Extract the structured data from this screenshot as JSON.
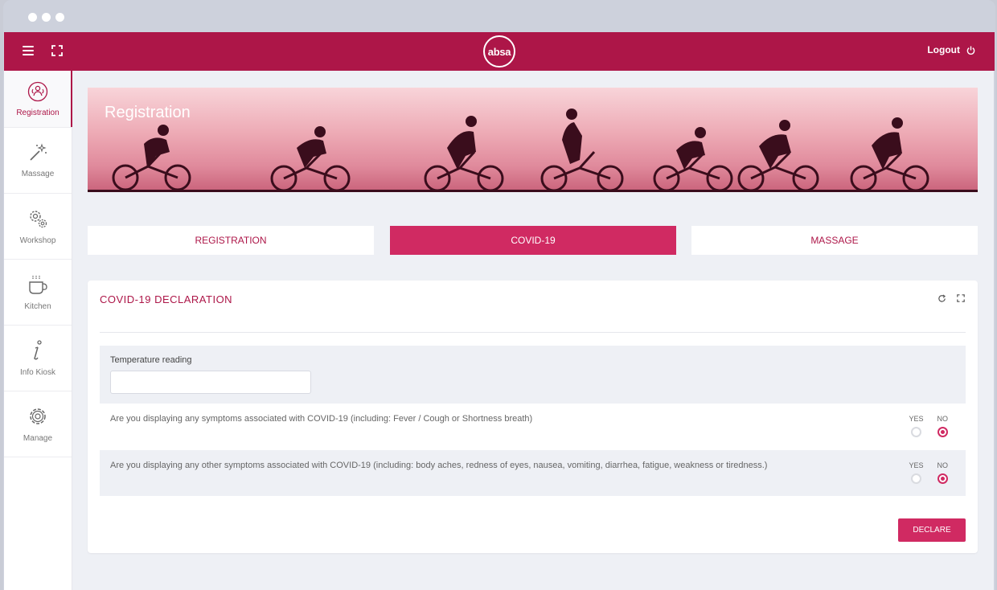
{
  "topbar": {
    "logo_text": "absa",
    "logout_label": "Logout",
    "colors": {
      "brand": "#ad1648",
      "accent": "#d02a62"
    }
  },
  "sidebar": {
    "items": [
      {
        "label": "Registration",
        "icon": "registration-icon",
        "active": true
      },
      {
        "label": "Massage",
        "icon": "magic-wand-icon"
      },
      {
        "label": "Workshop",
        "icon": "gears-icon"
      },
      {
        "label": "Kitchen",
        "icon": "coffee-cup-icon"
      },
      {
        "label": "Info Kiosk",
        "icon": "info-icon"
      },
      {
        "label": "Manage",
        "icon": "gear-icon"
      }
    ]
  },
  "banner": {
    "title": "Registration"
  },
  "tabs": [
    {
      "label": "REGISTRATION"
    },
    {
      "label": "COVID-19",
      "active": true
    },
    {
      "label": "MASSAGE"
    }
  ],
  "form": {
    "title": "COVID-19 DECLARATION",
    "temperature": {
      "label": "Temperature reading",
      "value": ""
    },
    "questions": [
      {
        "text": "Are you displaying any symptoms associated with COVID-19 (including: Fever / Cough or Shortness breath)",
        "yes_label": "YES",
        "no_label": "NO",
        "selected": "NO"
      },
      {
        "text": "Are you displaying any other symptoms associated with COVID-19 (including: body aches, redness of eyes, nausea, vomiting, diarrhea, fatigue, weakness or tiredness.)",
        "yes_label": "YES",
        "no_label": "NO",
        "selected": "NO"
      }
    ],
    "submit_label": "DECLARE"
  }
}
